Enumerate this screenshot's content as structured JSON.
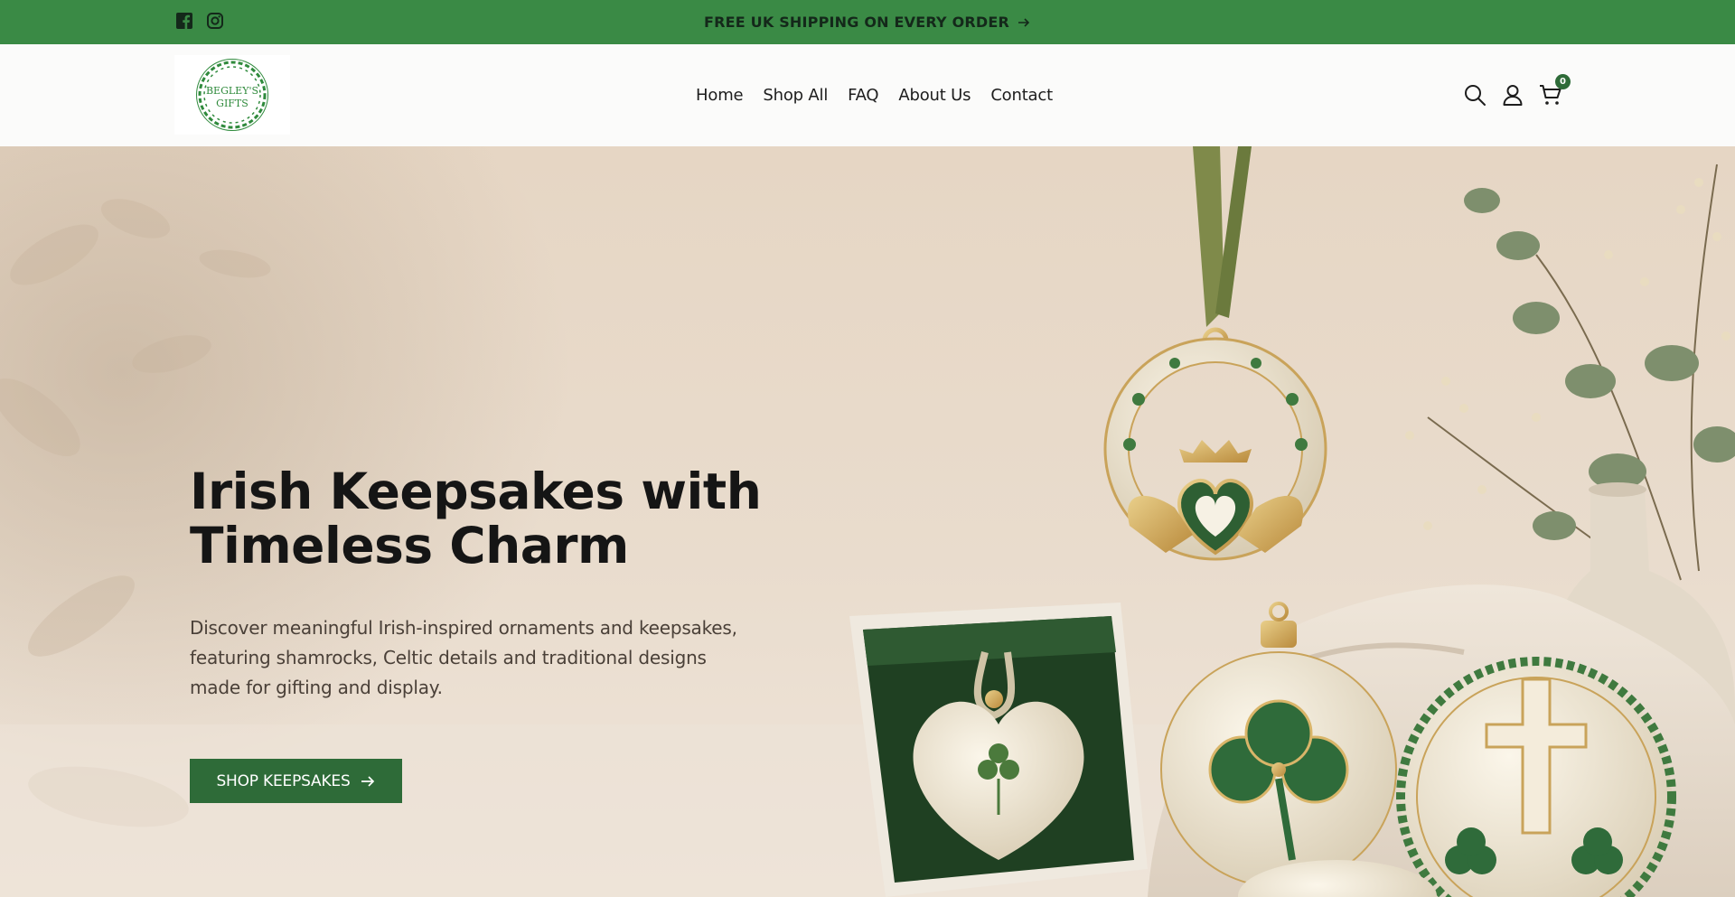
{
  "announcement": {
    "text": "FREE UK SHIPPING ON EVERY ORDER",
    "background": "#3a8a45",
    "social": [
      "facebook-icon",
      "instagram-icon"
    ]
  },
  "header": {
    "logo_text_line1": "BEGLEY'S",
    "logo_text_line2": "GIFTS",
    "nav": [
      "Home",
      "Shop All",
      "FAQ",
      "About Us",
      "Contact"
    ],
    "icons": [
      "search-icon",
      "account-icon",
      "cart-icon"
    ],
    "cart_count": "0"
  },
  "hero": {
    "title_line1": "Irish Keepsakes with",
    "title_line2": "Timeless Charm",
    "description": "Discover meaningful Irish-inspired ornaments and keepsakes, featuring shamrocks, Celtic details and traditional designs made for gifting and display.",
    "cta_label": "SHOP KEEPSAKES",
    "cta_color": "#2e6b38"
  }
}
